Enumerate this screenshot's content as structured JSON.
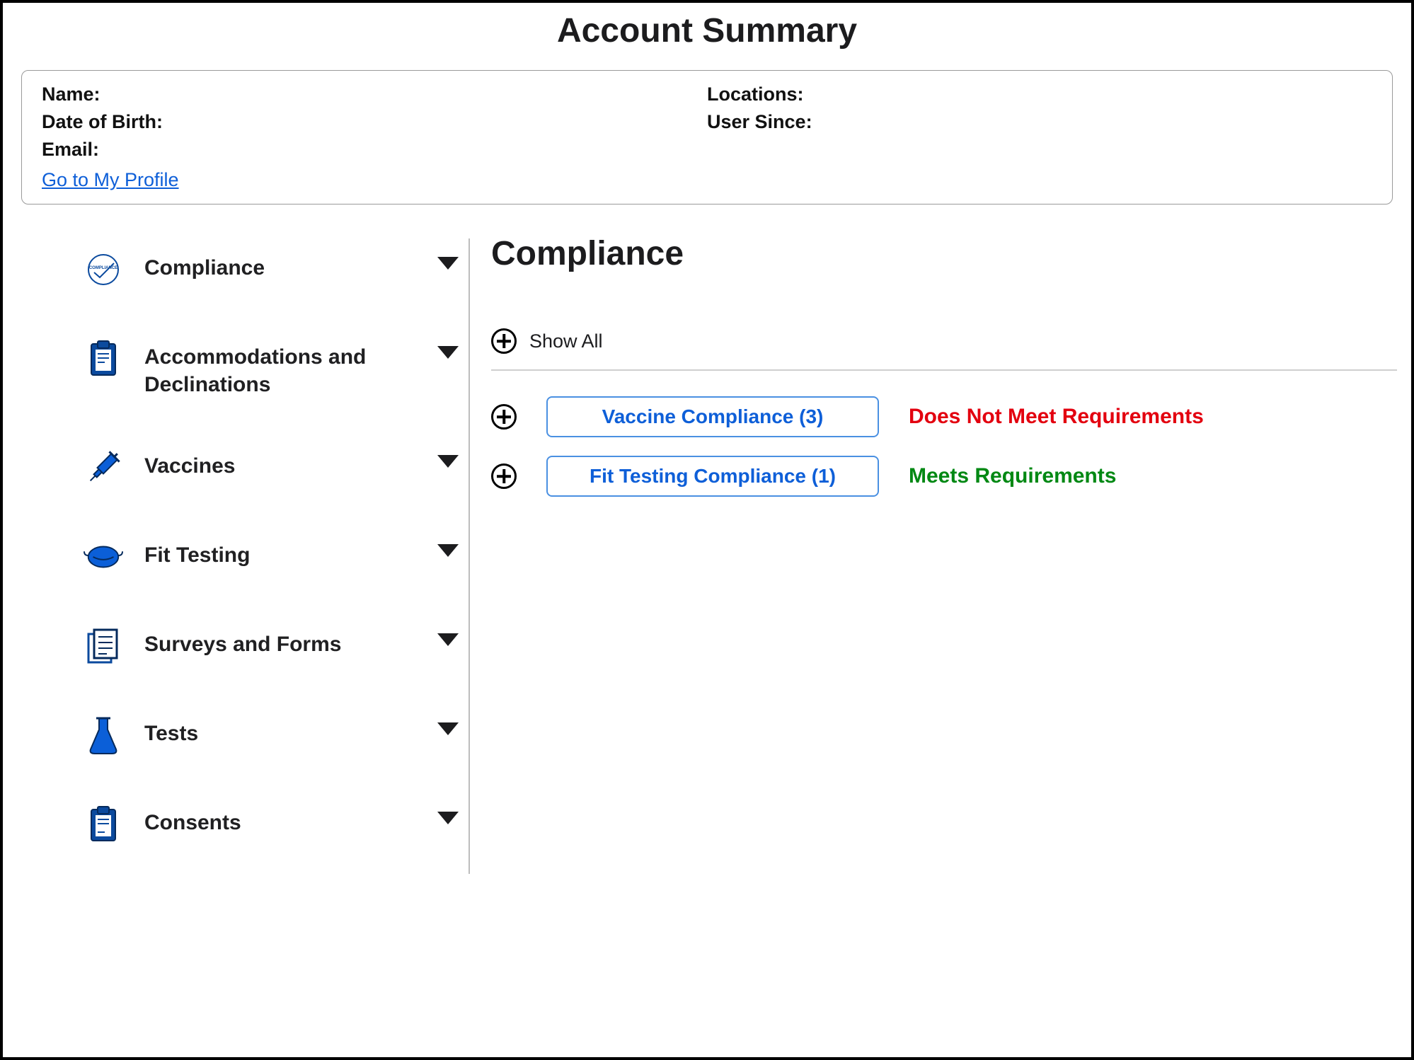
{
  "pageTitle": "Account Summary",
  "profile": {
    "nameLabel": "Name:",
    "dobLabel": "Date of Birth:",
    "emailLabel": "Email:",
    "locationsLabel": "Locations:",
    "userSinceLabel": "User Since:",
    "profileLink": "Go to My Profile"
  },
  "sidebar": {
    "items": [
      {
        "label": "Compliance",
        "icon": "compliance"
      },
      {
        "label": "Accommodations and Declinations",
        "icon": "clipboard"
      },
      {
        "label": "Vaccines",
        "icon": "syringe"
      },
      {
        "label": "Fit Testing",
        "icon": "mask"
      },
      {
        "label": "Surveys and Forms",
        "icon": "forms"
      },
      {
        "label": "Tests",
        "icon": "flask"
      },
      {
        "label": "Consents",
        "icon": "clipboard2"
      }
    ]
  },
  "main": {
    "title": "Compliance",
    "showAllLabel": "Show All",
    "items": [
      {
        "label": "Vaccine Compliance (3)",
        "status": "Does Not Meet Requirements",
        "statusClass": "fail"
      },
      {
        "label": "Fit Testing Compliance (1)",
        "status": "Meets Requirements",
        "statusClass": "pass"
      }
    ]
  }
}
